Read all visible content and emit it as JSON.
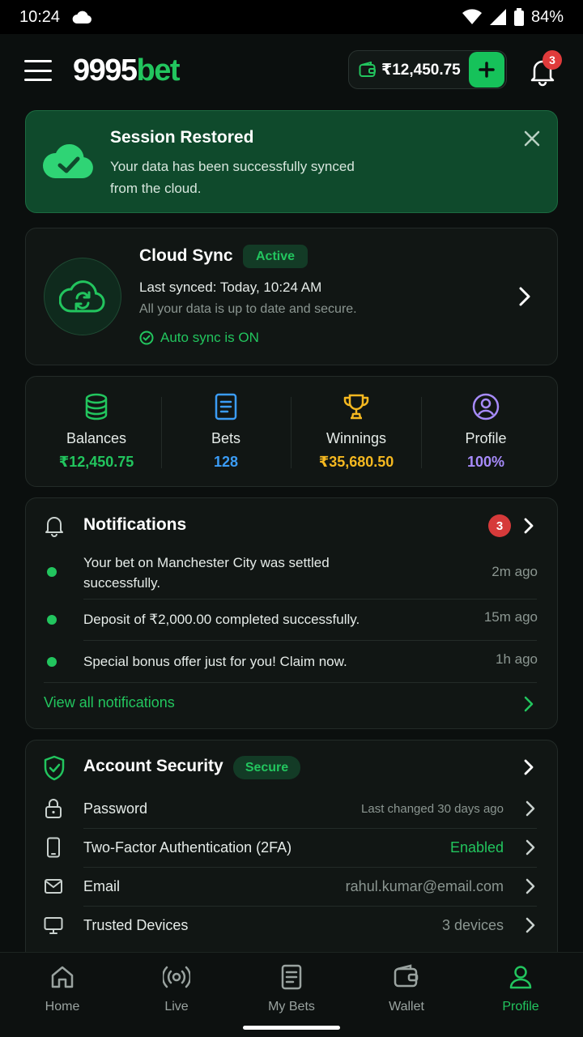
{
  "status_bar": {
    "time": "10:24",
    "battery": "84%"
  },
  "header": {
    "logo_num": "9995",
    "logo_bet": "bet",
    "wallet_amount": "₹12,450.75",
    "notification_count": "3"
  },
  "banner": {
    "title": "Session Restored",
    "text": "Your data has been successfully synced from the cloud."
  },
  "cloud_sync": {
    "title": "Cloud Sync",
    "badge": "Active",
    "last_synced": "Last synced: Today, 10:24 AM",
    "secure_text": "All your data is up to date and secure.",
    "auto_sync": "Auto sync is ON"
  },
  "stats": [
    {
      "label": "Balances",
      "value": "₹12,450.75",
      "color": "#22c55e",
      "icon": "coins-stack-icon"
    },
    {
      "label": "Bets",
      "value": "128",
      "color": "#3b9cf5",
      "icon": "document-icon"
    },
    {
      "label": "Winnings",
      "value": "₹35,680.50",
      "color": "#f5b820",
      "icon": "trophy-icon"
    },
    {
      "label": "Profile",
      "value": "100%",
      "color": "#a78bfa",
      "icon": "user-circle-icon"
    }
  ],
  "notifications": {
    "title": "Notifications",
    "count": "3",
    "items": [
      {
        "text": "Your bet on Manchester City was settled successfully.",
        "time": "2m ago"
      },
      {
        "text": "Deposit of ₹2,000.00 completed successfully.",
        "time": "15m ago"
      },
      {
        "text": "Special bonus offer just for you! Claim now.",
        "time": "1h ago"
      }
    ],
    "view_all": "View all notifications"
  },
  "security": {
    "title": "Account Security",
    "badge": "Secure",
    "rows": [
      {
        "label": "Password",
        "value": "Last changed 30 days ago",
        "icon": "lock-icon"
      },
      {
        "label": "Two-Factor Authentication (2FA)",
        "value": "Enabled",
        "icon": "phone-icon"
      },
      {
        "label": "Email",
        "value": "rahul.kumar@email.com",
        "icon": "mail-icon"
      },
      {
        "label": "Trusted Devices",
        "value": "3 devices",
        "icon": "monitor-icon"
      }
    ]
  },
  "bottom_nav": [
    {
      "label": "Home",
      "icon": "home-icon"
    },
    {
      "label": "Live",
      "icon": "live-broadcast-icon"
    },
    {
      "label": "My Bets",
      "icon": "bets-document-icon"
    },
    {
      "label": "Wallet",
      "icon": "wallet-icon"
    },
    {
      "label": "Profile",
      "icon": "profile-icon",
      "active": true
    }
  ],
  "colors": {
    "accent": "#22c55e",
    "background": "#0b0f0e",
    "card": "#111614",
    "danger": "#e03b3b"
  }
}
